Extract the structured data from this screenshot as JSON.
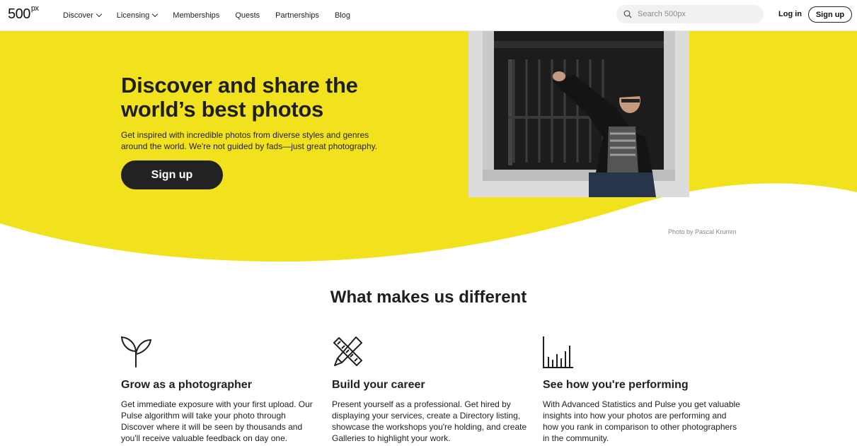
{
  "nav": {
    "logo": "500",
    "logo_sup": "px",
    "links": [
      {
        "label": "Discover",
        "dropdown": true
      },
      {
        "label": "Licensing",
        "dropdown": true
      },
      {
        "label": "Memberships",
        "dropdown": false
      },
      {
        "label": "Quests",
        "dropdown": false
      },
      {
        "label": "Partnerships",
        "dropdown": false
      },
      {
        "label": "Blog",
        "dropdown": false
      }
    ],
    "search_placeholder": "Search 500px",
    "login_label": "Log in",
    "signup_label": "Sign up"
  },
  "hero": {
    "title": "Discover and share the world’s best photos",
    "subtitle": "Get inspired with incredible photos from diverse styles and genres around the world. We're not guided by fads—just great photography.",
    "cta_label": "Sign up",
    "photo_credit": "Photo by Pascal Krumm"
  },
  "features": {
    "heading": "What makes us different",
    "items": [
      {
        "icon": "sprout-icon",
        "title": "Grow as a photographer",
        "text": "Get immediate exposure with your first upload. Our Pulse algorithm will take your photo through Discover where it will be seen by thousands and you'll receive valuable feedback on day one."
      },
      {
        "icon": "pencil-ruler-icon",
        "title": "Build your career",
        "text": "Present yourself as a professional. Get hired by displaying your services, create a Directory listing, showcase the workshops you're holding, and create Galleries to highlight your work."
      },
      {
        "icon": "bar-chart-icon",
        "title": "See how you're performing",
        "text": "With Advanced Statistics and Pulse you get valuable insights into how your photos are performing and how you rank in comparison to other photographers in the community."
      }
    ]
  },
  "colors": {
    "accent_yellow": "#f2e21d",
    "dark": "#222222"
  }
}
